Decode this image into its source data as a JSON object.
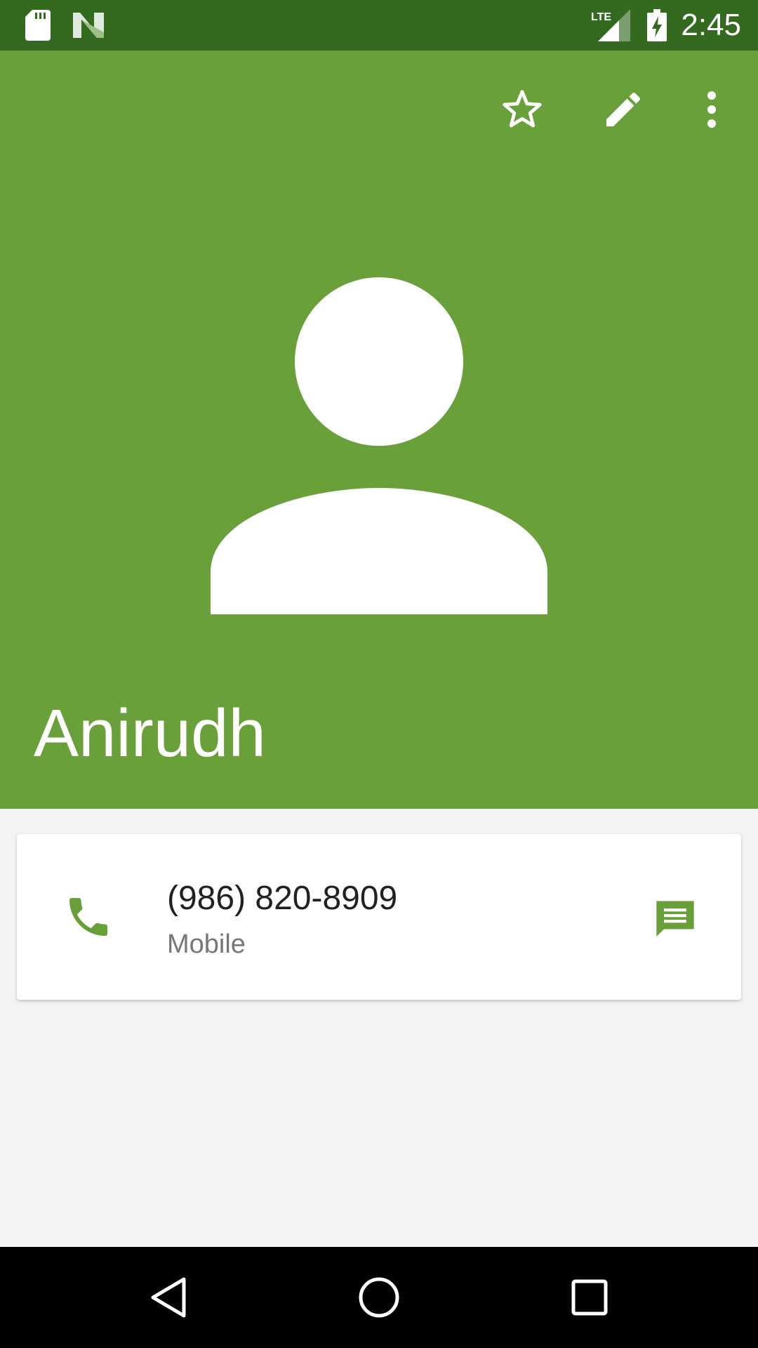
{
  "status_bar": {
    "time": "2:45",
    "network_label": "LTE",
    "icons": [
      "sd-card-icon",
      "n-logo-icon",
      "lte-signal-icon",
      "battery-charging-icon"
    ]
  },
  "toolbar": {
    "actions": [
      "star-icon",
      "edit-pencil-icon",
      "more-vert-icon"
    ]
  },
  "contact": {
    "name": "Anirudh",
    "avatar_icon": "default-person-avatar-icon",
    "header_color": "#6aa03a"
  },
  "phone_entry": {
    "number": "(986) 820-8909",
    "type": "Mobile",
    "leading_icon": "phone-icon",
    "trailing_icon": "message-icon",
    "accent_color": "#689f38"
  },
  "nav_bar": {
    "buttons": [
      "back-icon",
      "home-icon",
      "recents-icon"
    ]
  }
}
